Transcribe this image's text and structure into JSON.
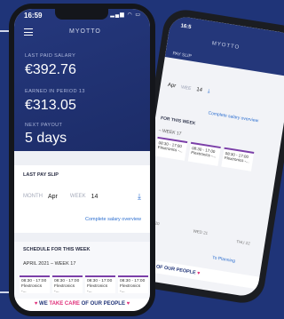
{
  "front": {
    "status_time": "16:59",
    "logo": "MYOTTO",
    "last_paid_label": "LAST PAID SALARY",
    "last_paid_value": "€392.76",
    "earned_label": "EARNED IN PERIOD 13",
    "earned_value": "€313.05",
    "next_payout_label": "NEXT PAYOUT",
    "next_payout_value": "5 days",
    "payslip": {
      "title": "LAST PAY SLIP",
      "month_label": "MONTH",
      "month_value": "Apr",
      "week_label": "WEEK",
      "week_value": "14",
      "link": "Complete salary overview"
    },
    "schedule": {
      "title": "SCHEDULE FOR THIS WEEK",
      "week": "APRIL 2021 – WEEK 17",
      "shifts": [
        {
          "time": "08:30 - 17:00",
          "place": "Flextronics -..."
        },
        {
          "time": "08:30 - 17:00",
          "place": "Flextronics -..."
        },
        {
          "time": "08:30 - 17:00",
          "place": "Flextronics -..."
        },
        {
          "time": "08:30 - 17:00",
          "place": "Flextronics -..."
        }
      ]
    },
    "banner": {
      "we": "WE",
      "take": "TAKE CARE",
      "rest": "OF OUR PEOPLE"
    }
  },
  "back": {
    "time": "16:5",
    "logo": "MYOTTO",
    "payslip_title": "PAY SLIP",
    "month": "Apr",
    "week_label": "WEE",
    "week": "14",
    "link": "Complete salary overview",
    "schedule_title": "FOR THIS WEEK",
    "week_text": "– WEEK 17",
    "shift_time": "08:30 - 17:00",
    "shift_place": "Flextronics -...",
    "bottom_a": "TUE 20",
    "bottom_b": "WED 21",
    "bottom_c": "THU 22",
    "planning": "To Planning",
    "banner": "CARE OF OUR PEOPLE"
  }
}
